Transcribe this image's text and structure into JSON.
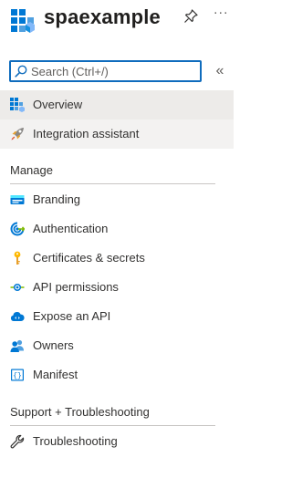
{
  "header": {
    "title": "spaexample",
    "logo_icon": "app-registration-icon",
    "pin_icon": "pin-icon",
    "more_label": "···"
  },
  "search": {
    "placeholder": "Search (Ctrl+/)",
    "value": ""
  },
  "collapse_label": "«",
  "nav_top": [
    {
      "label": "Overview",
      "icon": "grid-overview-icon",
      "selected": true
    },
    {
      "label": "Integration assistant",
      "icon": "rocket-icon",
      "selected": false
    }
  ],
  "sections": {
    "manage": "Manage",
    "support": "Support + Troubleshooting"
  },
  "manage_items": [
    {
      "label": "Branding",
      "icon": "branding-icon"
    },
    {
      "label": "Authentication",
      "icon": "authentication-icon"
    },
    {
      "label": "Certificates & secrets",
      "icon": "key-icon"
    },
    {
      "label": "API permissions",
      "icon": "api-permissions-icon"
    },
    {
      "label": "Expose an API",
      "icon": "cloud-api-icon"
    },
    {
      "label": "Owners",
      "icon": "owners-icon"
    },
    {
      "label": "Manifest",
      "icon": "manifest-icon"
    }
  ],
  "support_items": [
    {
      "label": "Troubleshooting",
      "icon": "wrench-icon"
    }
  ],
  "colors": {
    "accent": "#0f6cbd",
    "selected_bg": "#edebe9",
    "hover_bg": "#f3f2f1"
  }
}
